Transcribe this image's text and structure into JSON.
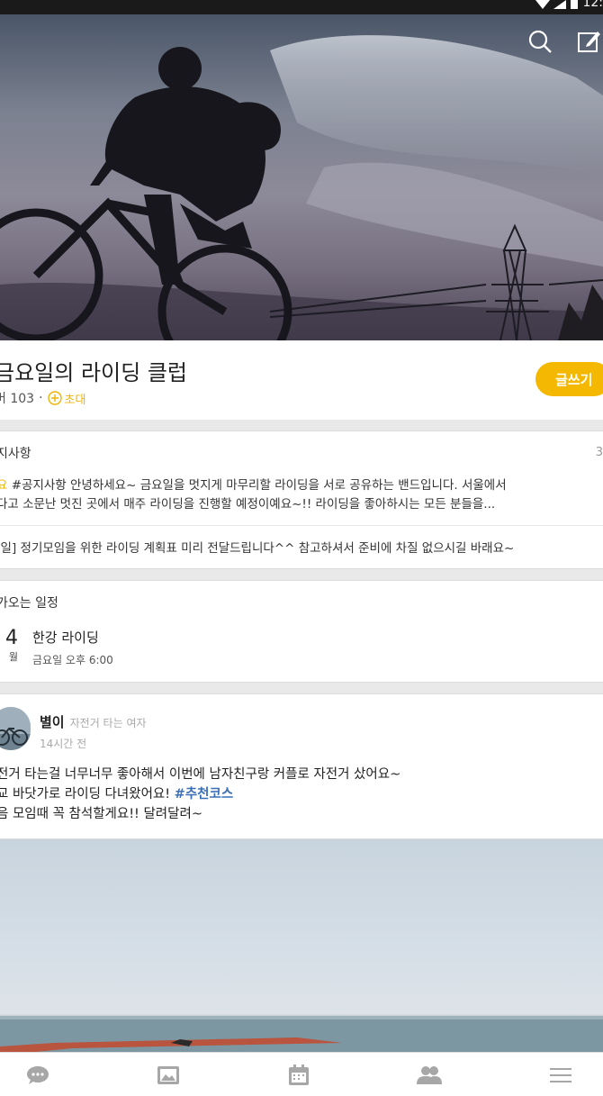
{
  "status_bar": {
    "time": "12:"
  },
  "header": {
    "search_icon": "search-icon",
    "compose_icon": "compose-icon"
  },
  "club": {
    "title": "금요일의 라이딩 클럽",
    "member_label": "버 103",
    "separator": "·",
    "invite_label": "초대",
    "write_button": "글쓰기"
  },
  "notice": {
    "title": "지사항",
    "count": "3",
    "item1_tag": "요",
    "item1_text": " #공지사항 안녕하세요~ 금요일을 멋지게 마무리할 라이딩을 서로 공유하는 밴드입니다. 서울에서",
    "item1_text2": "다고 소문난 멋진 곳에서 매주 라이딩을 진행할 예정이예요~!! 라이딩을 좋아하시는 모든 분들을...",
    "item2_text": "|일]  정기모임을 위한 라이딩 계획표 미리 전달드립니다^^ 참고하셔서 준비에 차질 없으시길 바래요~"
  },
  "events": {
    "title": "가오는 일정",
    "day": "4",
    "month": "월",
    "name": "한강 라이딩",
    "time": "금요일 오후 6:00"
  },
  "post": {
    "author": "별이",
    "author_desc": "자전거 타는 여자",
    "time": "14시간 전",
    "line1": "전거 타는걸 너무너무 좋아해서 이번에 남자친구랑 커플로 자전거 샀어요~",
    "line2_prefix": "교 바닷가로 라이딩 다녀왔어요! ",
    "hashtag": "#추천코스",
    "line3": "음 모임때 꼭 참석할게요!! 달려달려~"
  },
  "bottom_nav": {
    "items": [
      "chat-icon",
      "photo-icon",
      "calendar-icon",
      "members-icon",
      "menu-icon"
    ]
  },
  "colors": {
    "accent": "#f5b800",
    "hashtag": "#3a6fb7"
  }
}
